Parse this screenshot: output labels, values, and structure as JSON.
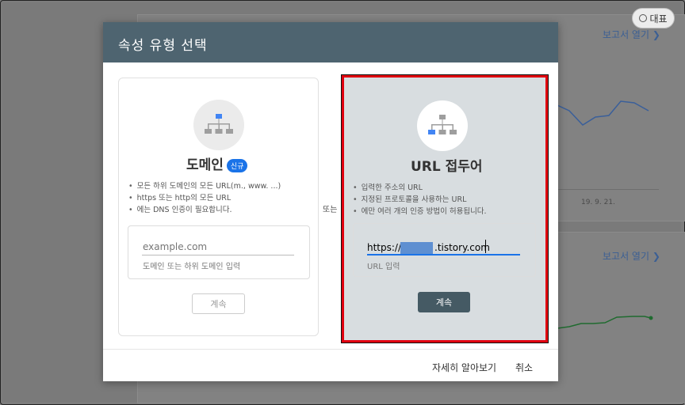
{
  "background": {
    "badge_label": "대표",
    "report_link_1": "보고서 열기 ❯",
    "report_link_2": "보고서 열기 ❯",
    "axis_date": "19. 9. 21."
  },
  "dialog": {
    "title": "속성 유형 선택",
    "or_label": "또는",
    "domain_card": {
      "title": "도메인",
      "new_badge": "신규",
      "bullets": [
        "모든 하위 도메인의 모든 URL(m., www. ...)",
        "https 또는 http의 모든 URL",
        "에는 DNS 인증이 필요합니다."
      ],
      "input_placeholder": "example.com",
      "helper": "도메인 또는 하위 도메인 입력",
      "button": "계속"
    },
    "url_card": {
      "title": "URL 접두어",
      "bullets": [
        "입력한 주소의 URL",
        "지정된 프로토콜을 사용하는 URL",
        "에만 여러 개의 인증 방법이 허용됩니다."
      ],
      "input_value": "https://          .tistory.com",
      "input_prefix": "https://",
      "input_suffix": ".tistory.com",
      "helper": "URL 입력",
      "button": "계속"
    },
    "footer": {
      "learn_more": "자세히 알아보기",
      "cancel": "취소"
    }
  },
  "colors": {
    "header": "#4e6470",
    "accent_blue": "#1a73e8",
    "highlight_border": "#e0000f",
    "primary_button": "#455a64"
  }
}
